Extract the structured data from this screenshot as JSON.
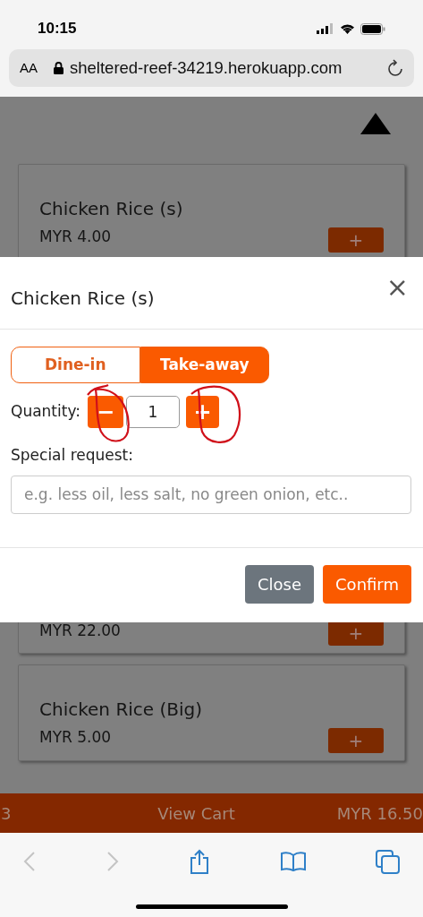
{
  "status_bar": {
    "time": "10:15"
  },
  "browser": {
    "text_size": "AA",
    "url": "sheltered-reef-34219.herokuapp.com"
  },
  "menu_items": [
    {
      "name": "Chicken Rice (s)",
      "price": "MYR 4.00",
      "button": "+"
    },
    {
      "price": "MYR 22.00",
      "button": "+"
    },
    {
      "name": "Chicken Rice (Big)",
      "price": "MYR 5.00",
      "button": "+"
    }
  ],
  "modal": {
    "title": "Chicken Rice (s)",
    "close_icon": "×",
    "order_types": [
      {
        "label": "Dine-in",
        "selected": false
      },
      {
        "label": "Take-away",
        "selected": true
      }
    ],
    "quantity_label": "Quantity:",
    "decrease": "−",
    "quantity": "1",
    "increase": "+",
    "special_request_label": "Special request:",
    "special_request_placeholder": "e.g. less oil, less salt, no green onion, etc..",
    "buttons": [
      {
        "label": "Close",
        "kind": "secondary"
      },
      {
        "label": "Confirm",
        "kind": "primary"
      }
    ]
  },
  "cart_bar": {
    "count": "3",
    "label": "View Cart",
    "total": "MYR 16.50"
  }
}
